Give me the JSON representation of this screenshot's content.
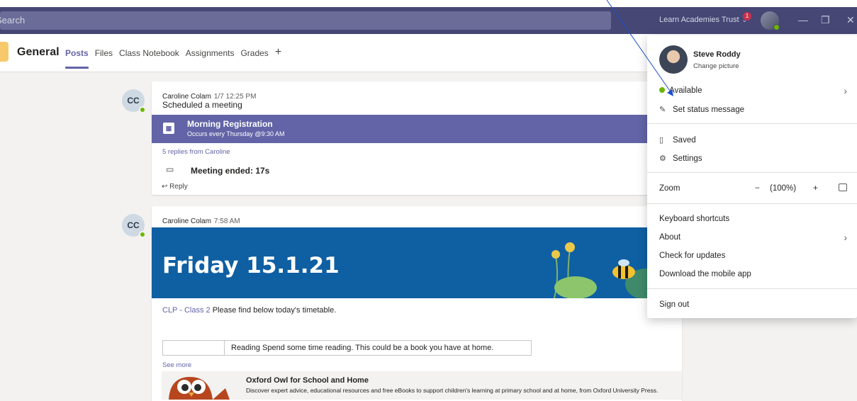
{
  "titlebar": {
    "search_placeholder": "Search",
    "org_name": "Learn Academies Trust",
    "notification_count": "1",
    "minimize": "—",
    "restore": "❐",
    "close": "✕"
  },
  "channel": {
    "name": "General",
    "tabs": [
      {
        "label": "Posts",
        "active": true
      },
      {
        "label": "Files"
      },
      {
        "label": "Class Notebook"
      },
      {
        "label": "Assignments"
      },
      {
        "label": "Grades"
      }
    ],
    "add_tab": "+"
  },
  "posts": [
    {
      "initials": "CC",
      "author": "Caroline Colam",
      "time": "1/7 12:25 PM",
      "text": "Scheduled a meeting",
      "meeting_title": "Morning Registration",
      "meeting_sub": "Occurs every Thursday @9:30 AM",
      "replies": "5 replies from Caroline",
      "meeting_ended": "Meeting ended: 17s",
      "reply_label": "Reply"
    },
    {
      "initials": "CC",
      "author": "Caroline Colam",
      "time": "7:58 AM",
      "banner_text": "Friday 15.1.21",
      "mention": "CLP - Class 2",
      "text": "Please find below today's timetable.",
      "table_text": "Reading Spend some time reading. This could be a book you have at home.",
      "see_more": "See more",
      "link_card": {
        "title": "Oxford Owl for School and Home",
        "description": "Discover expert advice, educational resources and free eBooks to support children's learning at primary school and at home, from Oxford University Press."
      }
    }
  ],
  "profile_menu": {
    "name": "Steve Roddy",
    "change_picture": "Change picture",
    "status": "Available",
    "set_status": "Set status message",
    "saved": "Saved",
    "settings": "Settings",
    "zoom_label": "Zoom",
    "zoom_minus": "−",
    "zoom_value": "(100%)",
    "zoom_plus": "+",
    "keyboard_shortcuts": "Keyboard shortcuts",
    "about": "About",
    "check_updates": "Check for updates",
    "download_app": "Download the mobile app",
    "sign_out": "Sign out"
  },
  "colors": {
    "titlebar": "#464775",
    "brand": "#6264a7",
    "presence": "#6bb700",
    "banner": "#0f5fa3"
  }
}
